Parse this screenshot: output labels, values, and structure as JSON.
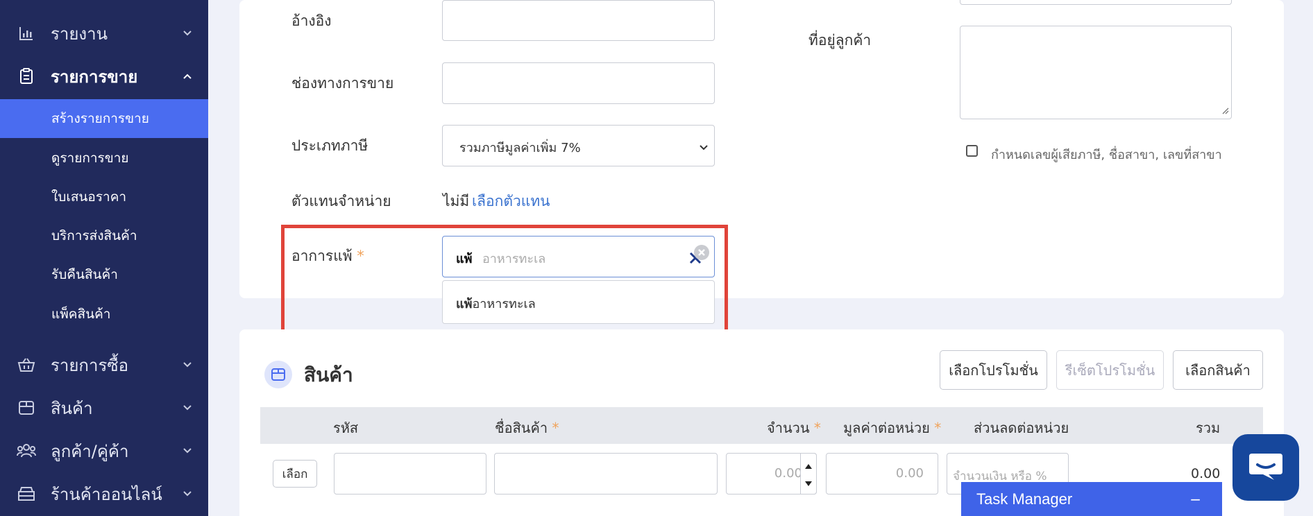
{
  "sidebar": {
    "report": "รายงาน",
    "sales": "รายการขาย",
    "sub_items": [
      "สร้างรายการขาย",
      "ดูรายการขาย",
      "ใบเสนอราคา",
      "บริการส่งสินค้า",
      "รับคืนสินค้า",
      "แพ็คสินค้า"
    ],
    "purchase": "รายการซื้อ",
    "products": "สินค้า",
    "customers": "ลูกค้า/คู่ค้า",
    "online_store": "ร้านค้าออนไลน์"
  },
  "form": {
    "reference_label": "อ้างอิง",
    "channel_label": "ช่องทางการขาย",
    "tax_type_label": "ประเภทภาษี",
    "tax_type_value": "รวมภาษีมูลค่าเพิ่ม 7%",
    "agent_label": "ตัวแทนจำหน่าย",
    "agent_none": "ไม่มี",
    "agent_select_link": "เลือกตัวแทน",
    "allergy_label": "อาการแพ้",
    "required_mark": "*",
    "allergy_typed": "แพ้",
    "allergy_hint": "อาหารทะเล",
    "suggestion_bold": "แพ้",
    "suggestion_rest": "อาหารทะเล",
    "customer_address_label": "ที่อยู่ลูกค้า",
    "tax_id_checkbox_label": "กำหนดเลขผู้เสียภาษี, ชื่อสาขา, เลขที่สาขา"
  },
  "products": {
    "title": "สินค้า",
    "select_promo": "เลือกโปรโมชั่น",
    "reset_promo": "รีเซ็ตโปรโมชั่น",
    "select_product": "เลือกสินค้า",
    "col_code": "รหัส",
    "col_name": "ชื่อสินค้า",
    "col_qty": "จำนวน",
    "col_unit_price": "มูลค่าต่อหน่วย",
    "col_discount": "ส่วนลดต่อหน่วย",
    "col_total": "รวม",
    "row_select_btn": "เลือก",
    "qty_placeholder": "0.00",
    "price_placeholder": "0.00",
    "discount_placeholder": "จำนวนเงิน หรือ %",
    "row_total": "0.00"
  },
  "task_manager": {
    "title": "Task Manager",
    "minimize": "−"
  },
  "colors": {
    "sidebar_bg": "#212a5c",
    "active_item": "#4a6cf0",
    "highlight_border": "#e0443a",
    "required": "#f0a35c",
    "link": "#3b73cf"
  }
}
